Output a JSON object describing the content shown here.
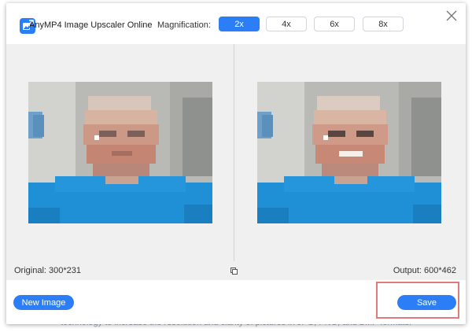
{
  "backdrop": {
    "text": "technology to increase the resolution and clarity of pictures in JPG, PNG, and BMP formats."
  },
  "header": {
    "app_title": "AnyMP4 Image Upscaler Online",
    "magnification_label": "Magnification:",
    "magnification_options": [
      "2x",
      "4x",
      "6x",
      "8x"
    ],
    "selected": "2x"
  },
  "info": {
    "original_label": "Original: 300*231",
    "output_label": "Output: 600*462"
  },
  "footer": {
    "new_image_label": "New Image",
    "save_label": "Save"
  },
  "colors": {
    "accent": "#2b7ef5",
    "highlight_box": "#e07b7b",
    "preview_bg": "#f0f0f1"
  },
  "icons": [
    "app-logo-icon",
    "close-icon",
    "compare-icon"
  ]
}
